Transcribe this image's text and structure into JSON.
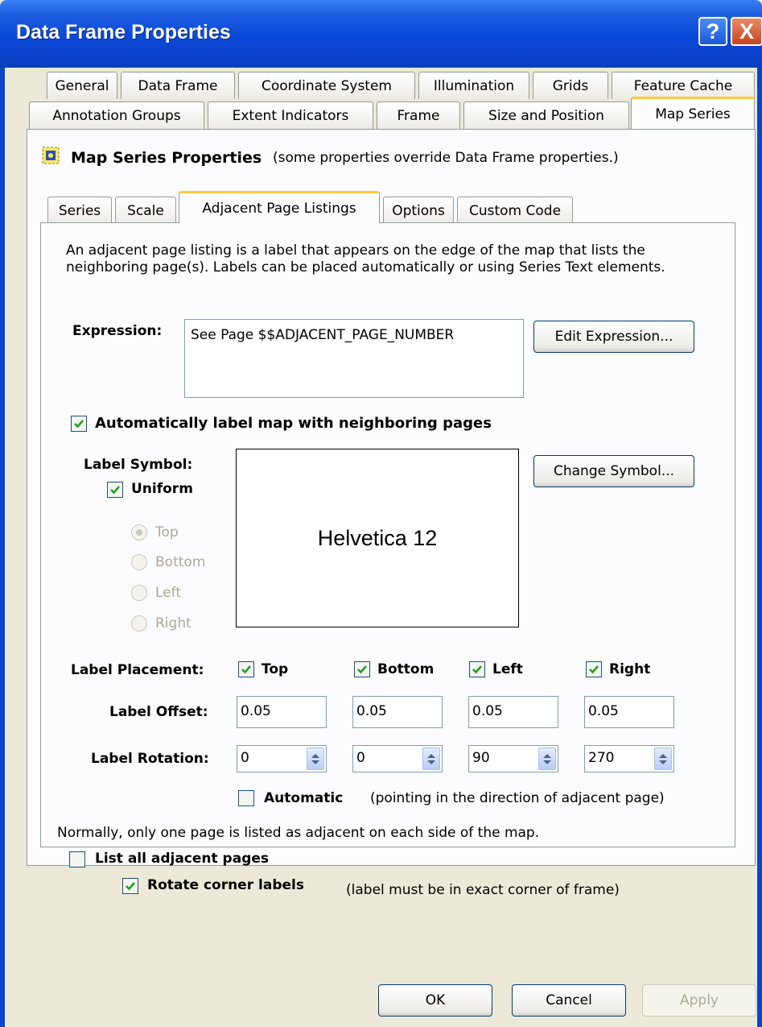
{
  "window": {
    "title": "Data Frame Properties",
    "help_label": "?",
    "close_label": "X"
  },
  "tabs_row1": [
    "General",
    "Data Frame",
    "Coordinate System",
    "Illumination",
    "Grids",
    "Feature Cache"
  ],
  "tabs_row2": [
    "Annotation Groups",
    "Extent Indicators",
    "Frame",
    "Size and Position",
    "Map Series"
  ],
  "active_tab": "Map Series",
  "map_series": {
    "heading": "Map Series Properties",
    "heading_note": "(some properties override Data Frame properties.)",
    "icon": "map-series-icon"
  },
  "sub_tabs": [
    "Series",
    "Scale",
    "Adjacent Page Listings",
    "Options",
    "Custom Code"
  ],
  "active_sub_tab": "Adjacent Page Listings",
  "content": {
    "description": "An adjacent page listing is a label that appears on the edge of the map that lists the neighboring page(s). Labels can be placed automatically or using Series Text elements.",
    "expression_label": "Expression:",
    "expression_value": "See Page $$ADJACENT_PAGE_NUMBER",
    "edit_expression_button": "Edit Expression...",
    "auto_label_checkbox": "Automatically label map with neighboring pages",
    "auto_label_checked": true,
    "label_symbol_label": "Label Symbol:",
    "uniform_checkbox": "Uniform",
    "uniform_checked": true,
    "symbol_preview": "Helvetica  12",
    "change_symbol_button": "Change Symbol...",
    "radio_options": [
      "Top",
      "Bottom",
      "Left",
      "Right"
    ],
    "radio_selected": "Top",
    "label_placement_label": "Label Placement:",
    "placement": [
      {
        "label": "Top",
        "checked": true
      },
      {
        "label": "Bottom",
        "checked": true
      },
      {
        "label": "Left",
        "checked": true
      },
      {
        "label": "Right",
        "checked": true
      }
    ],
    "label_offset_label": "Label Offset:",
    "offsets": [
      "0.05",
      "0.05",
      "0.05",
      "0.05"
    ],
    "label_rotation_label": "Label Rotation:",
    "rotations": [
      "0",
      "0",
      "90",
      "270"
    ],
    "automatic_checkbox": "Automatic",
    "automatic_checked": false,
    "automatic_note": "(pointing in the direction of adjacent page)",
    "normally_text": "Normally, only one page is listed as adjacent on each side of the map.",
    "list_all_checkbox": "List all adjacent pages",
    "list_all_checked": false,
    "rotate_corner_checkbox": "Rotate corner labels",
    "rotate_corner_checked": true,
    "rotate_corner_note": "(label must be in exact corner of frame)"
  },
  "footer": {
    "ok": "OK",
    "cancel": "Cancel",
    "apply": "Apply"
  },
  "colors": {
    "title_bar": "#0b45c8",
    "dialog_bg": "#ece9d8",
    "active_tab_accent": "#ffc83c",
    "checkmark": "#21a121"
  }
}
